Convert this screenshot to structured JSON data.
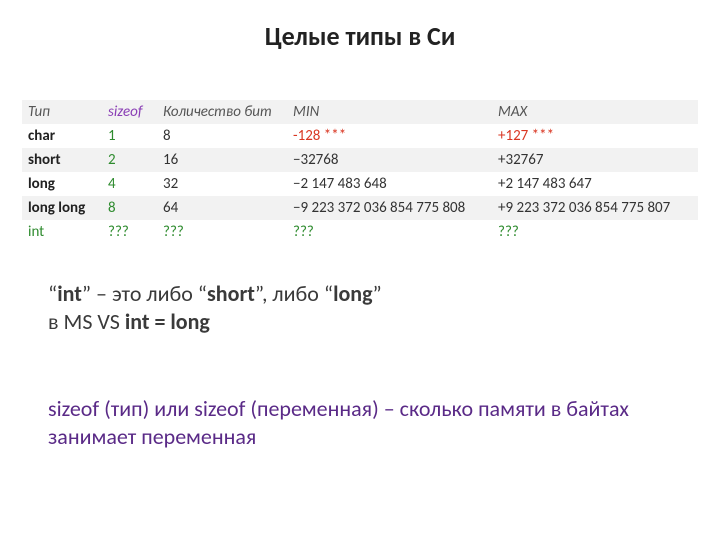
{
  "title": "Целые типы в Си",
  "table": {
    "headers": {
      "type": "Тип",
      "sizeof": "sizeof",
      "bits": "Количество бит",
      "min": "MIN",
      "max": "MAX"
    },
    "rows": [
      {
        "type": "char",
        "sizeof": "1",
        "bits": "8",
        "min": " -128 ***",
        "max": " +127 ***",
        "min_red": true,
        "max_red": true
      },
      {
        "type": "short",
        "sizeof": "2",
        "bits": "16",
        "min": "−32768",
        "max": "+32767"
      },
      {
        "type": "long",
        "sizeof": "4",
        "bits": "32",
        "min": "−2 147 483 648",
        "max": "+2 147 483 647"
      },
      {
        "type": "long long",
        "sizeof": "8",
        "bits": "64",
        "min": "−9 223 372 036 854 775 808",
        "max": "+9 223 372 036 854 775 807"
      },
      {
        "type": "int",
        "sizeof": "???",
        "bits": "???",
        "min": "???",
        "max": "???",
        "all_green": true
      }
    ]
  },
  "note1": {
    "p1_a": "“",
    "p1_b": "int",
    "p1_c": "” – это либо “",
    "p1_d": "short",
    "p1_e": "”, либо “",
    "p1_f": "long",
    "p1_g": "”",
    "p2_a": "в MS VS ",
    "p2_b": "int = long"
  },
  "note2": "sizeof (тип) или sizeof (переменная) – сколько памяти в байтах занимает переменная",
  "chart_data": {
    "type": "table",
    "title": "Целые типы в Си",
    "columns": [
      "Тип",
      "sizeof",
      "Количество бит",
      "MIN",
      "MAX"
    ],
    "rows": [
      [
        "char",
        1,
        8,
        "-128 ***",
        "+127 ***"
      ],
      [
        "short",
        2,
        16,
        -32768,
        32767
      ],
      [
        "long",
        4,
        32,
        -2147483648,
        2147483647
      ],
      [
        "long long",
        8,
        64,
        "-9 223 372 036 854 775 808",
        "+9 223 372 036 854 775 807"
      ],
      [
        "int",
        "???",
        "???",
        "???",
        "???"
      ]
    ]
  }
}
